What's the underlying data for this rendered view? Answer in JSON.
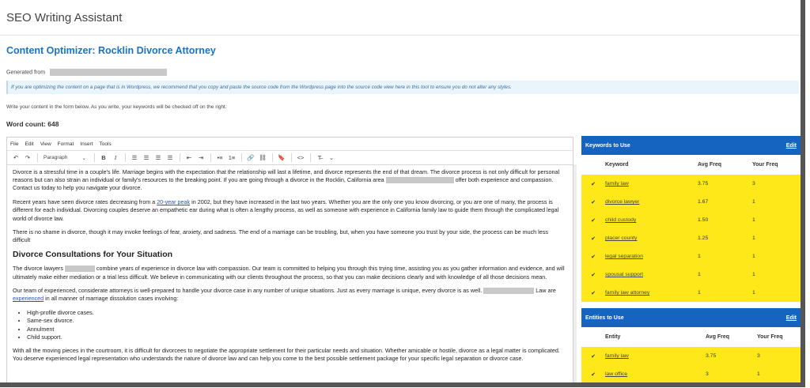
{
  "app_title": "SEO Writing Assistant",
  "page_title": "Content Optimizer: Rocklin Divorce Attorney",
  "generated_from_label": "Generated from",
  "info_banner": "If you are optimizing the content on a page that is in Wordpress, we recommend that you copy and paste the source code from the Wordpress page into the source code view here in this tool to ensure you do not alter any styles.",
  "instructions": "Write your content in the form below. As you write, your keywords will be checked off on the right.",
  "word_count": "Word count: 648",
  "editor": {
    "menu": [
      "File",
      "Edit",
      "View",
      "Format",
      "Insert",
      "Tools"
    ],
    "format_select": "Paragraph",
    "content": {
      "p1a": "Divorce is a stressful time in a couple's life. Marriage begins with the expectation that the relationship will last a lifetime, and divorce represents the end of that dream. The divorce process is not only difficult for personal reasons but can also strain an individual or family's resources to the breaking point. If you are going through a divorce in the Rocklin, California area",
      "p1b": "offer both experience and compassion. Contact us today to help you navigate your divorce.",
      "p2a": "Recent years have seen divorce rates decreasing from a",
      "p2_link": "20-year peak",
      "p2b": "in 2002, but they have increased in the last two years. Whether you are the only one you know divorcing, or you are one of many, the process is different for each individual. Divorcing couples deserve an empathetic ear during what is often a lengthy process, as well as someone with experience in California family law to guide them through the complicated legal world of divorce law.",
      "p3": "There is no shame in divorce, though it may invoke feelings of fear, anxiety, and sadness. The end of a marriage can be troubling, but, when you have someone you trust by your side, the process can be much less difficult",
      "h2": "Divorce Consultations for Your Situation",
      "p4a": "The divorce lawyers",
      "p4b": "combine years of experience in divorce law with compassion. Our team is committed to helping you through this trying time, assisting you as you gather information and evidence, and will ultimately make either mediation or a trial less difficult. We believe in communicating with our clients throughout the process, so that you can make decisions clearly and with knowledge of all those decisions mean.",
      "p5a": "Our team of experienced, considerate attorneys is well-prepared to handle your divorce case in any number of unique situations. Just as every marriage is unique, every divorce is as well.",
      "p5b": "Law are",
      "p5_link": "experienced",
      "p5c": "in all manner of marriage dissolution cases involving:",
      "list": [
        "High-profile divorce cases.",
        "Same-sex divorce.",
        "Annulment",
        "Child support."
      ],
      "p6": "With all the moving pieces in the courtroom, it is difficult for divorcees to negotiate the appropriate settlement for their particular needs and situation. Whether amicable or hostile, divorce as a legal matter is complicated. You deserve experienced legal representation who understands the nature of divorce law and can help you come to the best possible settlement package for your specific legal separation or divorce case."
    }
  },
  "keywords_panel": {
    "title": "Keywords to Use",
    "edit": "Edit",
    "columns": [
      "Keyword",
      "Avg Freq",
      "Your Freq"
    ],
    "rows": [
      {
        "keyword": "family law",
        "avg": "3.75",
        "your": "3"
      },
      {
        "keyword": "divorce lawyer",
        "avg": "1.67",
        "your": "1"
      },
      {
        "keyword": "child custody",
        "avg": "1.50",
        "your": "1"
      },
      {
        "keyword": "placer county",
        "avg": "1.25",
        "your": "1"
      },
      {
        "keyword": "legal separation",
        "avg": "1",
        "your": "1"
      },
      {
        "keyword": "spousal support",
        "avg": "1",
        "your": "1"
      },
      {
        "keyword": "family law attorney",
        "avg": "1",
        "your": "1"
      }
    ]
  },
  "entities_panel": {
    "title": "Entities to Use",
    "edit": "Edit",
    "columns": [
      "Entity",
      "Avg Freq",
      "Your Freq"
    ],
    "rows": [
      {
        "entity": "family law",
        "avg": "3.75",
        "your": "3"
      },
      {
        "entity": "law office",
        "avg": "3",
        "your": "1"
      }
    ]
  },
  "colors": {
    "accent": "#1565c0",
    "title_blue": "#1a73c7",
    "highlight": "#ffe81a",
    "banner_bg": "#eaf4fb"
  },
  "icons": {
    "check": "check-icon"
  }
}
